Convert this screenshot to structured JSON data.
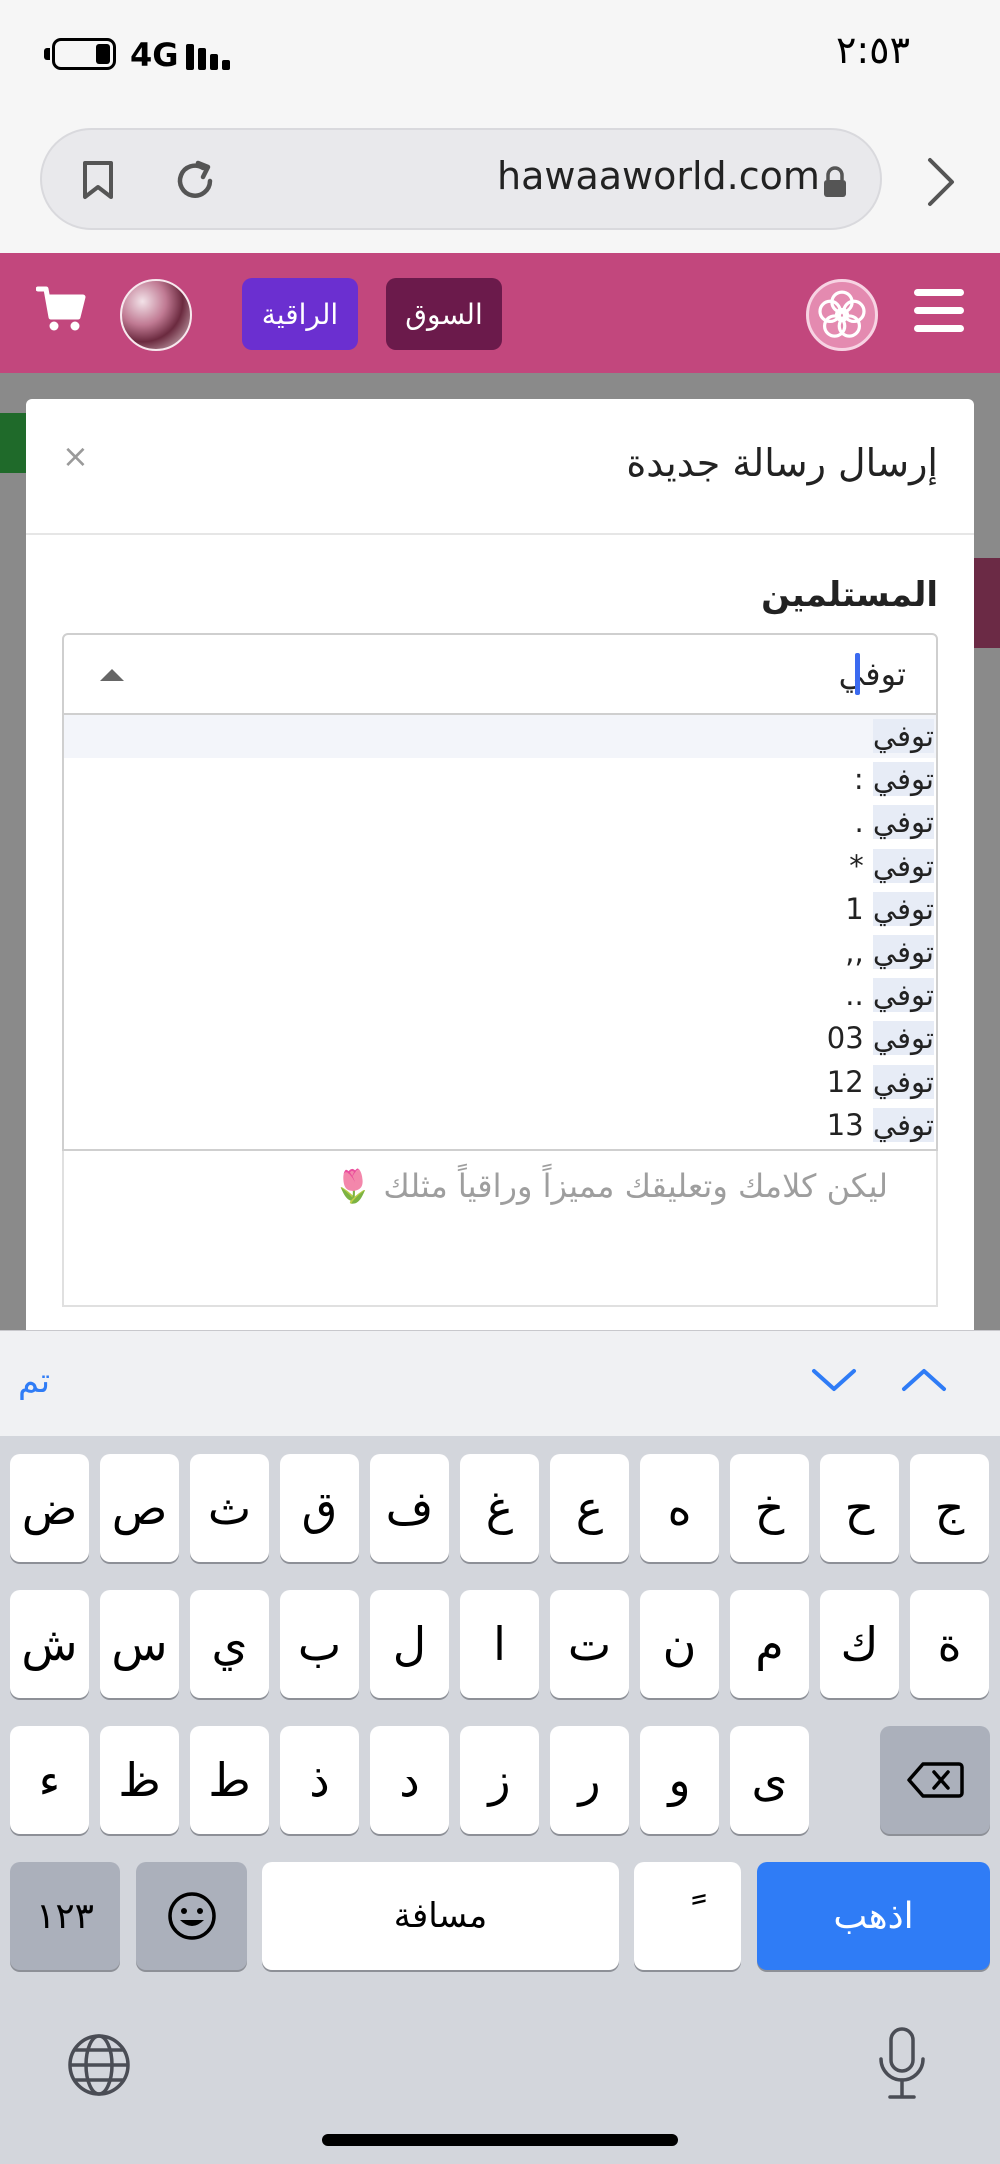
{
  "status_bar": {
    "time": "٢:٥٣",
    "network": "4G"
  },
  "browser": {
    "url": "hawaaworld.com"
  },
  "site_header": {
    "buttons": [
      "الراقية",
      "السوق"
    ],
    "accent_color": "#c2477d"
  },
  "modal": {
    "title": "إرسال رسالة جديدة",
    "close_label": "×",
    "recipients_label": "المستلمين",
    "select_value": "توفي",
    "options": [
      {
        "match": "توفي",
        "rest": ""
      },
      {
        "match": "توفي",
        "rest": " :"
      },
      {
        "match": "توفي",
        "rest": " ."
      },
      {
        "match": "توفي",
        "rest": " *"
      },
      {
        "match": "توفي",
        "rest": " 1"
      },
      {
        "match": "توفي",
        "rest": " ,,"
      },
      {
        "match": "توفي",
        "rest": " .."
      },
      {
        "match": "توفي",
        "rest": " 03"
      },
      {
        "match": "توفي",
        "rest": " 12"
      },
      {
        "match": "توفي",
        "rest": " 13"
      }
    ],
    "message_placeholder": "ليكن كلامك وتعليقك مميزاً وراقياً مثلك 🌷"
  },
  "keyboard_accessory": {
    "done_label": "تم"
  },
  "keyboard": {
    "row1": [
      "ض",
      "ص",
      "ث",
      "ق",
      "ف",
      "غ",
      "ع",
      "ه",
      "خ",
      "ح",
      "ج"
    ],
    "row2": [
      "ش",
      "س",
      "ي",
      "ب",
      "ل",
      "ا",
      "ت",
      "ن",
      "م",
      "ك",
      "ة"
    ],
    "row3": [
      "ء",
      "ظ",
      "ط",
      "ذ",
      "د",
      "ز",
      "ر",
      "و",
      "ى"
    ],
    "numbers_label": "١٢٣",
    "space_label": "مسافة",
    "diacritic_label": "ً",
    "go_label": "اذهب"
  }
}
